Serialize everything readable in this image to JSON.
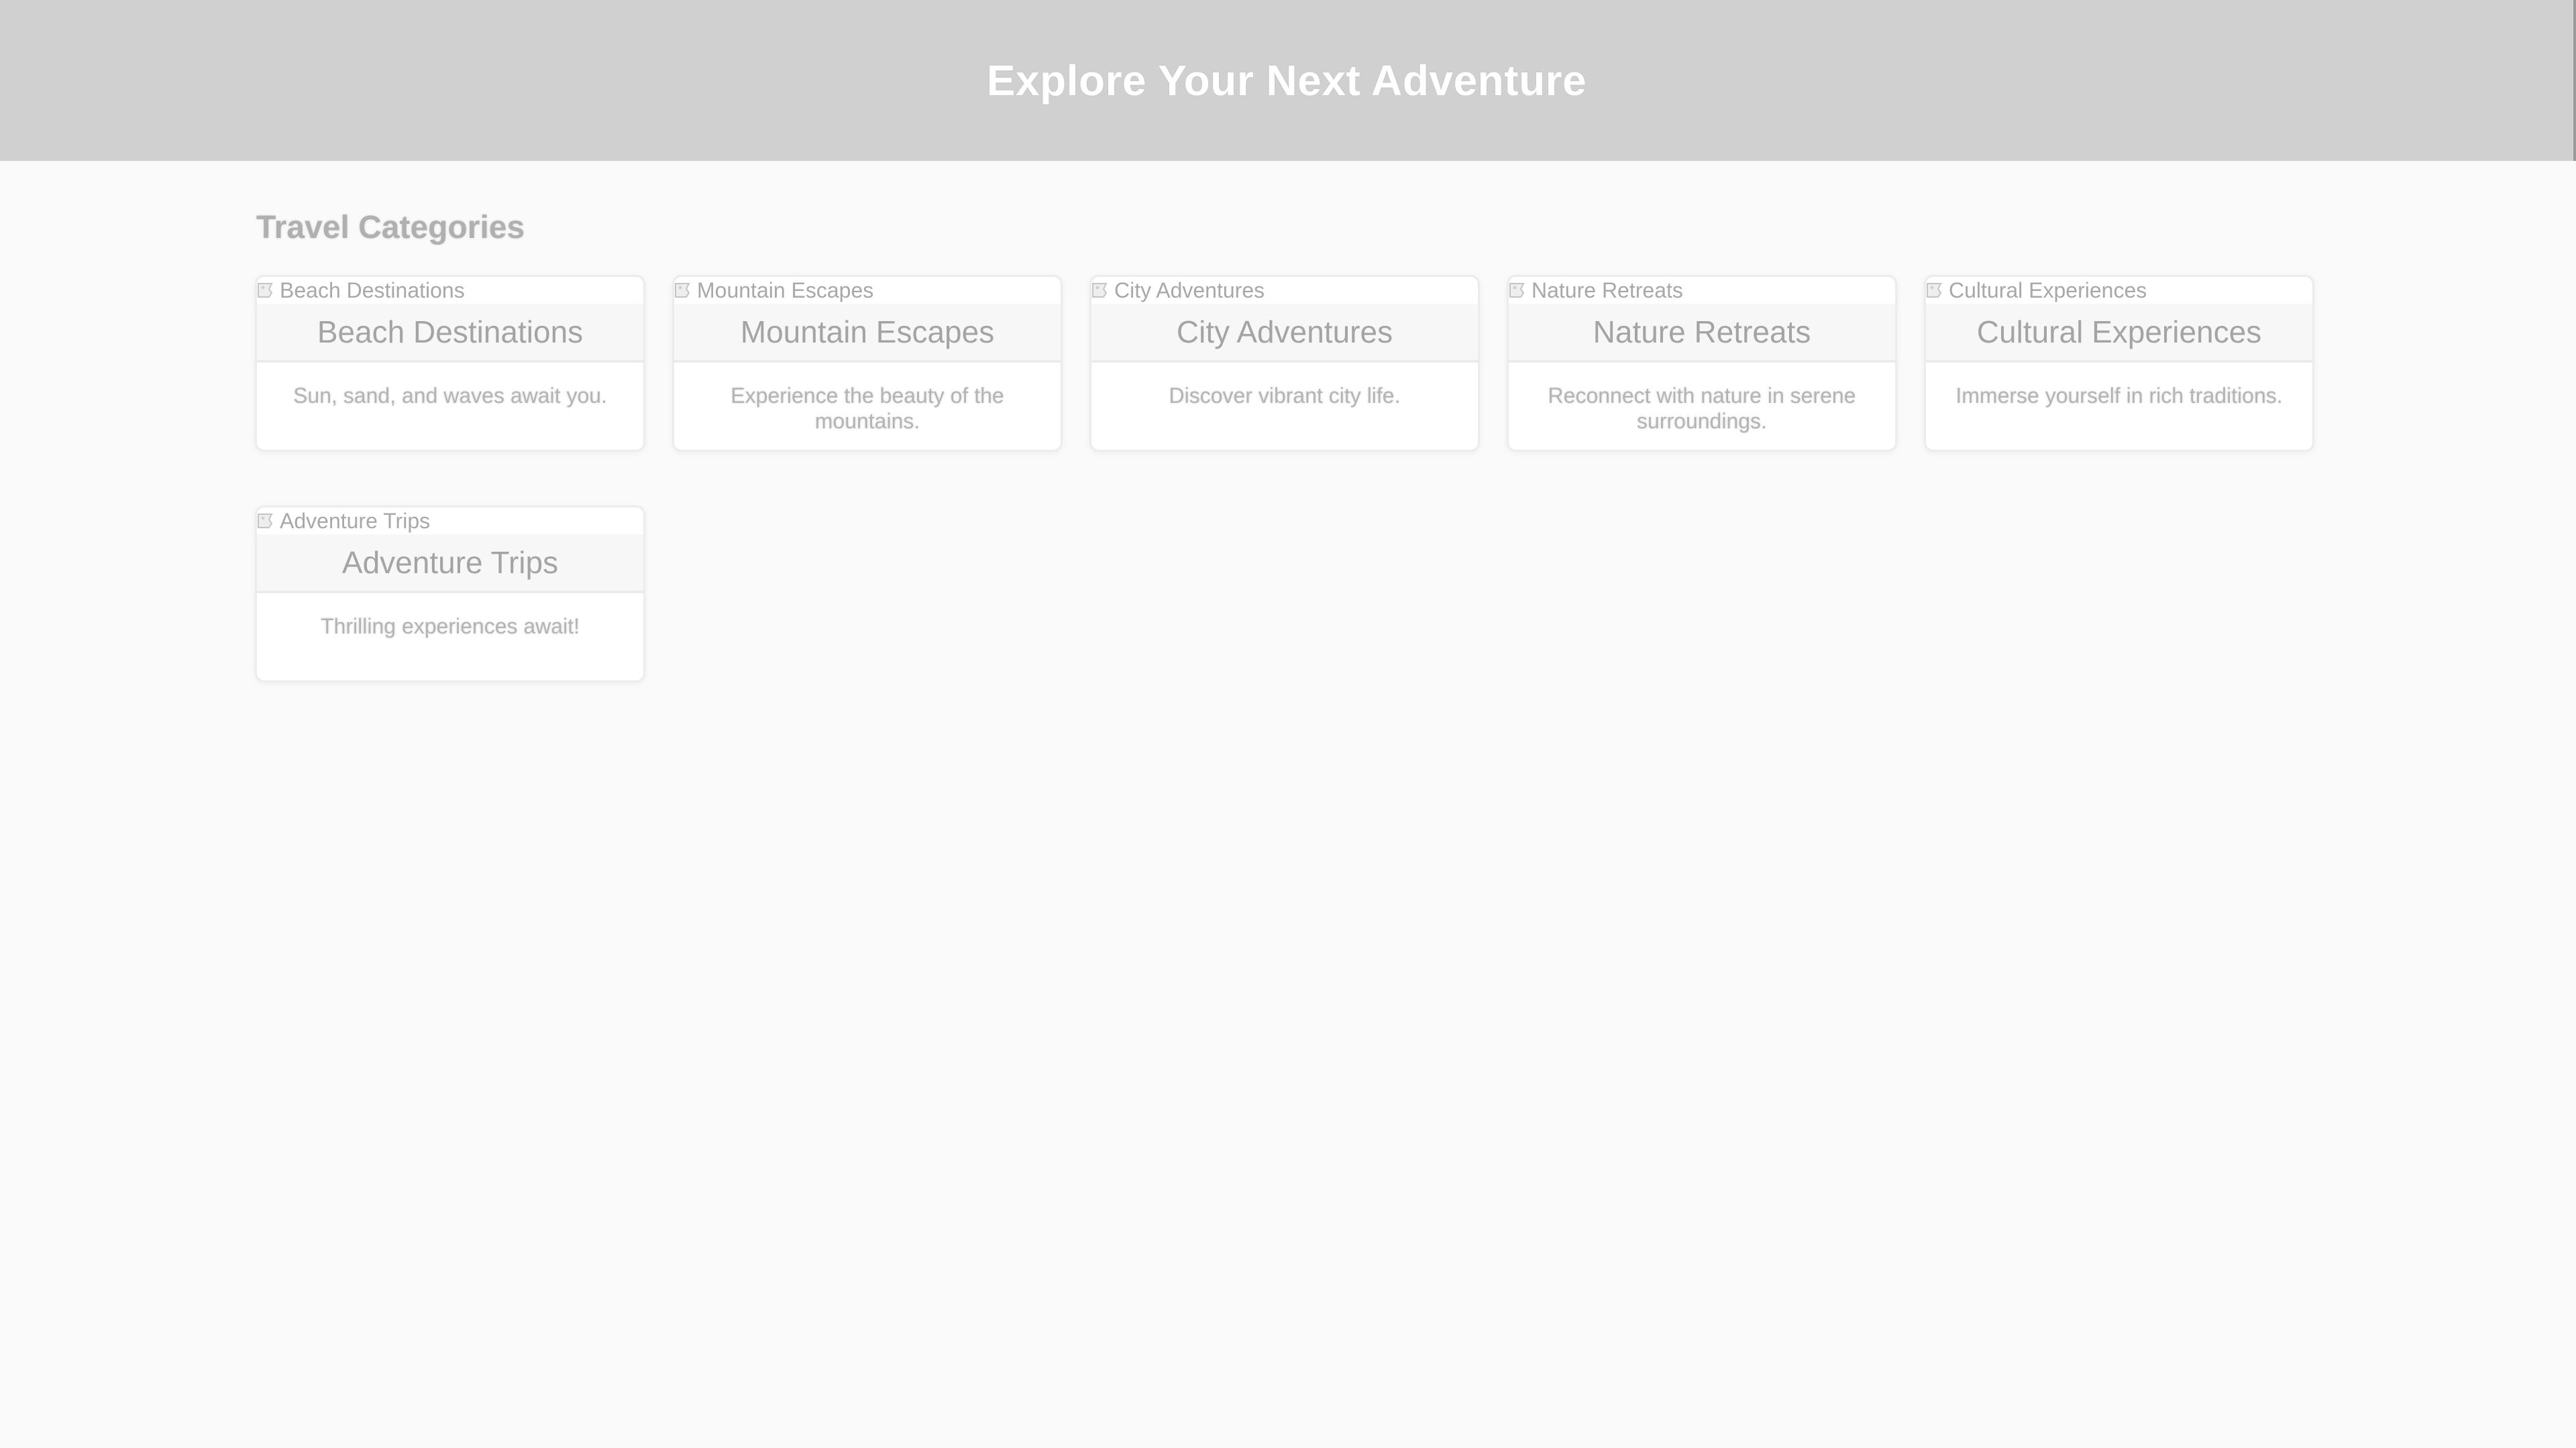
{
  "header": {
    "title": "Explore Your Next Adventure"
  },
  "section": {
    "title": "Travel Categories"
  },
  "categories": [
    {
      "image_alt": "Beach Destinations",
      "title": "Beach Destinations",
      "description": "Sun, sand, and waves await you."
    },
    {
      "image_alt": "Mountain Escapes",
      "title": "Mountain Escapes",
      "description": "Experience the beauty of the mountains."
    },
    {
      "image_alt": "City Adventures",
      "title": "City Adventures",
      "description": "Discover vibrant city life."
    },
    {
      "image_alt": "Nature Retreats",
      "title": "Nature Retreats",
      "description": "Reconnect with nature in serene surroundings."
    },
    {
      "image_alt": "Cultural Experiences",
      "title": "Cultural Experiences",
      "description": "Immerse yourself in rich traditions."
    },
    {
      "image_alt": "Adventure Trips",
      "title": "Adventure Trips",
      "description": "Thrilling experiences await!"
    }
  ],
  "colors": {
    "header_bg": "#d0d0d0",
    "page_bg": "#fafafa",
    "card_bg": "#ffffff",
    "title_bar_bg": "#f7f7f7"
  },
  "icons": {
    "image_placeholder": "broken-image-icon"
  }
}
